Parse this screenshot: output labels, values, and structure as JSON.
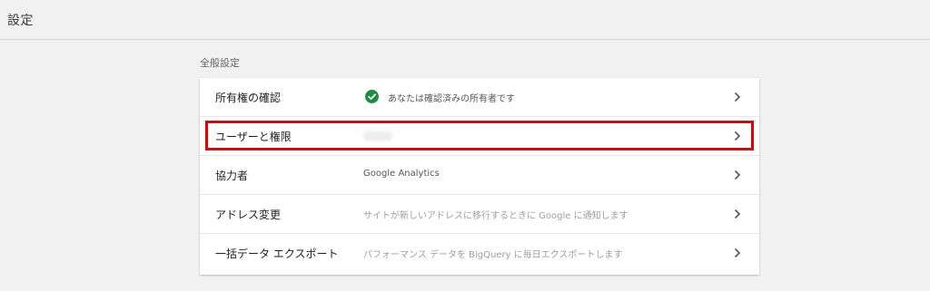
{
  "header": {
    "title": "設定"
  },
  "section": {
    "label": "全般設定"
  },
  "rows": [
    {
      "title": "所有権の確認",
      "value": "あなたは確認済みの所有者です",
      "icon": "check-circle-icon",
      "value_color": "#555555"
    },
    {
      "title": "ユーザーと権限",
      "value": "",
      "highlighted": true
    },
    {
      "title": "協力者",
      "value": "Google Analytics"
    },
    {
      "title": "アドレス変更",
      "value": "サイトが新しいアドレスに移行するときに Google に通知します"
    },
    {
      "title": "一括データ エクスポート",
      "value": "パフォーマンス データを BigQuery に毎日エクスポートします"
    }
  ],
  "colors": {
    "background": "#f1f1f1",
    "card": "#ffffff",
    "check": "#1e8e3e",
    "highlight_border": "#e30000"
  }
}
